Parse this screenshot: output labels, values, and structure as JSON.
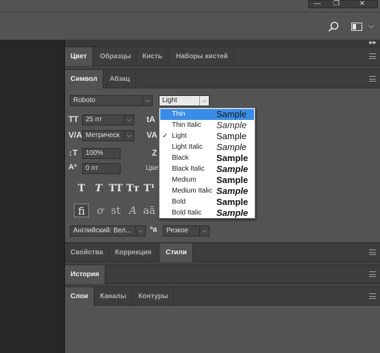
{
  "window_controls": {
    "minimize": "—",
    "restore": "❐",
    "close": "✕"
  },
  "toolbar": {
    "search_icon": "search-icon",
    "workspace_icon": "workspace-icon",
    "chevron": "⌵"
  },
  "color_panel": {
    "tabs": [
      "Цвет",
      "Образцы",
      "Кисть",
      "Наборы кистей"
    ],
    "active_tab": 0
  },
  "character_panel": {
    "tabs": [
      "Символ",
      "Абзац"
    ],
    "font_family": "Roboto",
    "font_style": "Light",
    "font_size": "25 пт",
    "kerning": "Метрическ",
    "vertical_scale": "100%",
    "baseline_shift": "0 пт",
    "color_label": "Цвет",
    "language": "Английский: Вел...",
    "anti_alias": "Резкое",
    "type_buttons": [
      "T",
      "T",
      "TT",
      "Tт",
      "T¹"
    ],
    "opentype_buttons": [
      "fi",
      "ơ",
      "st",
      "A",
      "aā"
    ]
  },
  "font_style_menu": {
    "sample_text": "Sample",
    "selected": 2,
    "highlighted": 0,
    "options": [
      "Thin",
      "Thin Italic",
      "Light",
      "Light Italic",
      "Black",
      "Black Italic",
      "Medium",
      "Medium Italic",
      "Bold",
      "Bold Italic"
    ]
  },
  "properties_panel": {
    "tabs": [
      "Свойства",
      "Коррекция",
      "Стили"
    ],
    "active_tab": 2
  },
  "history_panel": {
    "tabs": [
      "История"
    ]
  },
  "layers_panel": {
    "tabs": [
      "Слои",
      "Каналы",
      "Контуры"
    ],
    "active_tab": 0
  }
}
